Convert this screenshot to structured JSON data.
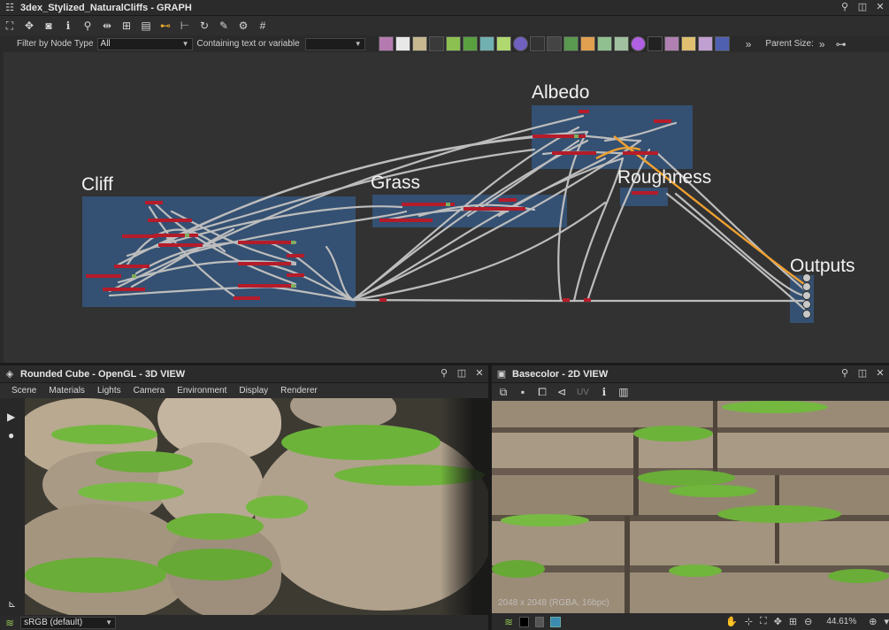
{
  "graph_window": {
    "title": "3dex_Stylized_NaturalCliffs - GRAPH",
    "filter_label": "Filter by Node Type",
    "filter_value": "All",
    "search_placeholder": "Containing text or variable",
    "parent_size_label": "Parent Size:",
    "more_label": "»",
    "frames": [
      {
        "label": "Albedo"
      },
      {
        "label": "Cliff"
      },
      {
        "label": "Grass"
      },
      {
        "label": "Roughness"
      },
      {
        "label": "Outputs"
      }
    ]
  },
  "view3d": {
    "title": "Rounded Cube - OpenGL - 3D VIEW",
    "menu": [
      "Scene",
      "Materials",
      "Lights",
      "Camera",
      "Environment",
      "Display",
      "Renderer"
    ],
    "colorspace": "sRGB (default)"
  },
  "view2d": {
    "title": "Basecolor - 2D VIEW",
    "uv_label": "UV",
    "info_overlay": "2048 x 2048 (RGBA, 16bpc)",
    "zoom": "44.61%"
  },
  "colors": {
    "frame": "#345c8a",
    "wire": "#bdbdbd",
    "wire_highlight": "#f0a030",
    "moss": "#6cb33a",
    "rock": "#a8998a"
  }
}
